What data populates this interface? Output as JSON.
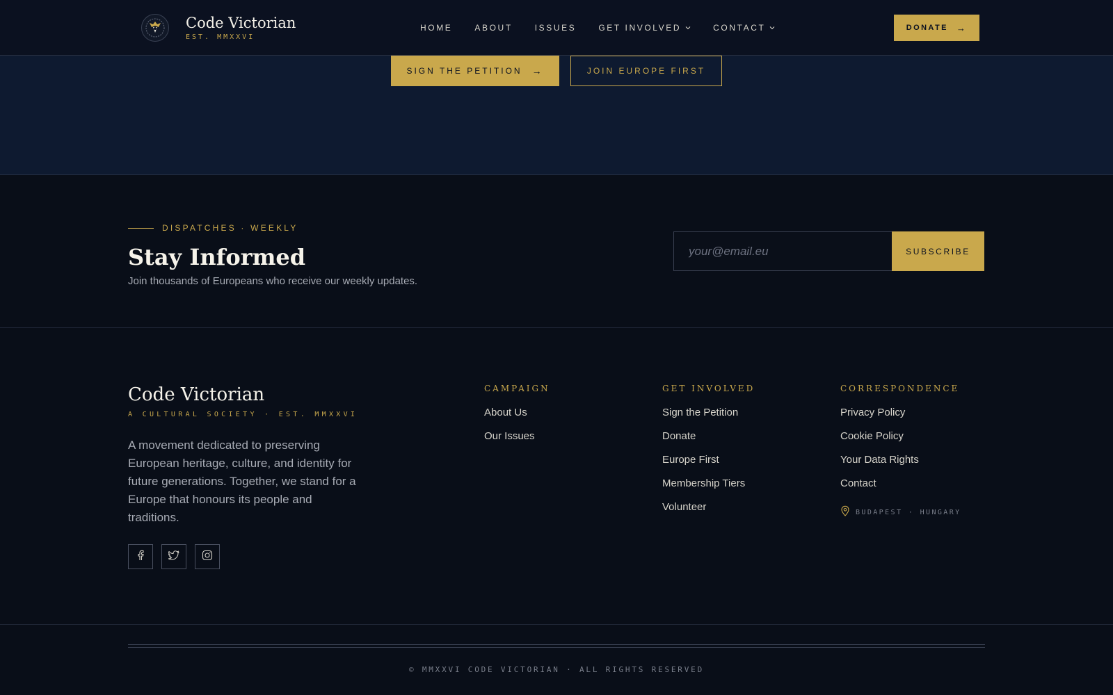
{
  "header": {
    "brand_name": "Code Victorian",
    "brand_est": "EST. MMXXVI",
    "nav": [
      {
        "label": "HOME",
        "has_dropdown": false
      },
      {
        "label": "ABOUT",
        "has_dropdown": false
      },
      {
        "label": "ISSUES",
        "has_dropdown": false
      },
      {
        "label": "GET INVOLVED",
        "has_dropdown": true
      },
      {
        "label": "CONTACT",
        "has_dropdown": true
      }
    ],
    "donate_label": "DONATE",
    "donate_arrow": "→"
  },
  "hero": {
    "primary_cta": "SIGN THE PETITION",
    "primary_arrow": "→",
    "secondary_cta": "JOIN EUROPE FIRST"
  },
  "newsletter": {
    "eyebrow": "DISPATCHES · WEEKLY",
    "title": "Stay Informed",
    "subtitle": "Join thousands of Europeans who receive our weekly updates.",
    "email_placeholder": "your@email.eu",
    "subscribe_label": "SUBSCRIBE"
  },
  "footer": {
    "brand_name": "Code Victorian",
    "tagline": "A CULTURAL SOCIETY · EST. MMXXVI",
    "description": "A movement dedicated to preserving European heritage, culture, and identity for future generations. Together, we stand for a Europe that honours its people and traditions.",
    "socials": [
      "facebook-icon",
      "twitter-icon",
      "instagram-icon"
    ],
    "columns": [
      {
        "title": "CAMPAIGN",
        "links": [
          "About Us",
          "Our Issues"
        ]
      },
      {
        "title": "GET INVOLVED",
        "links": [
          "Sign the Petition",
          "Donate",
          "Europe First",
          "Membership Tiers",
          "Volunteer"
        ]
      },
      {
        "title": "CORRESPONDENCE",
        "links": [
          "Privacy Policy",
          "Cookie Policy",
          "Your Data Rights",
          "Contact"
        ]
      }
    ],
    "location": "BUDAPEST · HUNGARY",
    "copyright": "© MMXXVI CODE VICTORIAN · ALL RIGHTS RESERVED"
  },
  "colors": {
    "accent_gold": "#c9a84c",
    "background_dark": "#090e18",
    "header_bg": "#0b1120",
    "hero_bg": "#0e1a30"
  }
}
